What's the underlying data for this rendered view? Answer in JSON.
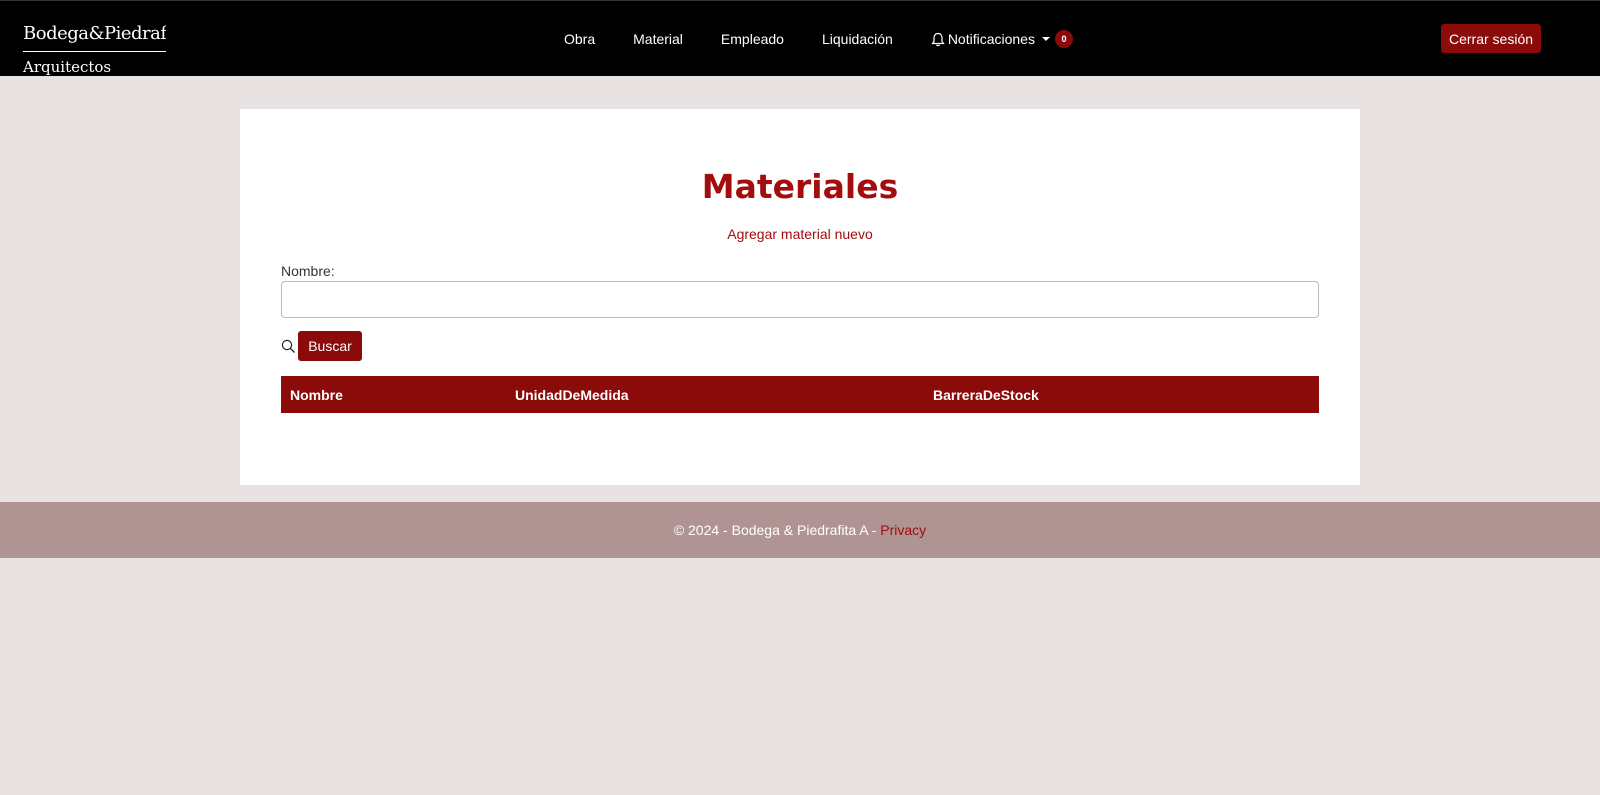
{
  "navbar": {
    "brand_name": "Bodega&Piedrafita",
    "brand_sub": "Arquitectos",
    "links": [
      "Obra",
      "Material",
      "Empleado",
      "Liquidación"
    ],
    "notifications_label": "Notificaciones",
    "notifications_count": "0",
    "logout_label": "Cerrar sesión"
  },
  "main": {
    "title": "Materiales",
    "add_link": "Agregar material nuevo",
    "search": {
      "label": "Nombre:",
      "value": "",
      "placeholder": "",
      "button": "Buscar"
    },
    "table": {
      "headers": [
        "Nombre",
        "UnidadDeMedida",
        "BarreraDeStock"
      ],
      "rows": []
    }
  },
  "footer": {
    "text": "© 2024 - Bodega & Piedrafita A - ",
    "privacy": "Privacy"
  },
  "colors": {
    "accent": "#8b0a0a",
    "title": "#a30d0d",
    "navbar": "#000000",
    "page_bg": "#e8e2e2",
    "footer_bg": "#b09494"
  }
}
